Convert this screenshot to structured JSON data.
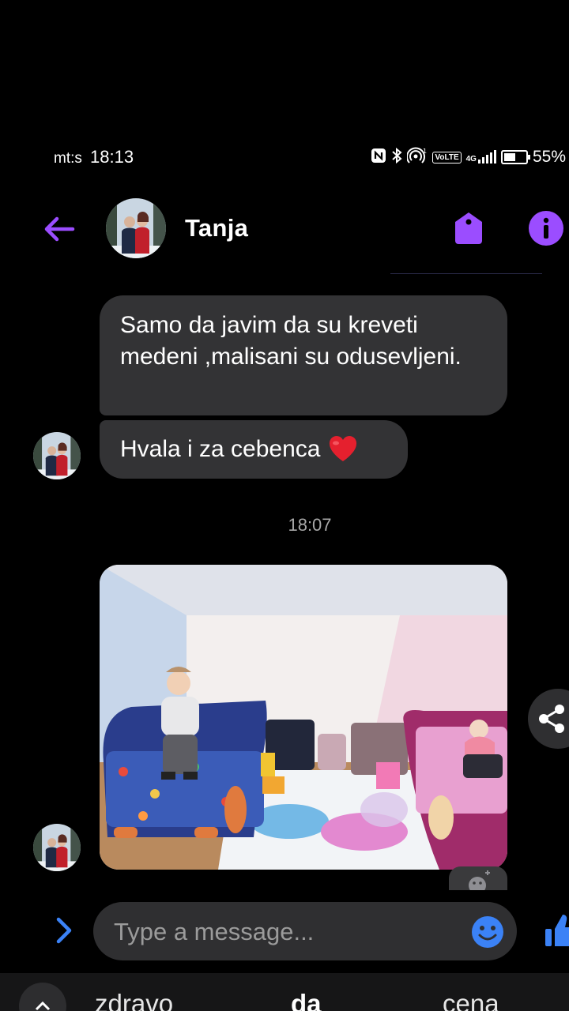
{
  "status_bar": {
    "carrier": "mt:s",
    "time": "18:13",
    "volte": "VoLTE",
    "network": "4G",
    "battery": "55%",
    "battery_level": 0.55,
    "icons": [
      "nfc-icon",
      "bluetooth-icon",
      "hotspot-icon",
      "volte-icon",
      "signal-icon",
      "battery-icon"
    ]
  },
  "header": {
    "contact_name": "Tanja",
    "icons": [
      "back-arrow-icon",
      "tag-icon",
      "info-icon"
    ],
    "accent": "#9B4DFF"
  },
  "messages": [
    {
      "text": "Samo da javim da su kreveti medeni ,malisani su odusevljeni."
    },
    {
      "text": "Hvala i za cebenca",
      "emoji": "red-heart"
    }
  ],
  "timestamp": "18:07",
  "photo_message": {
    "icons": [
      "share-icon",
      "add-reaction-icon"
    ]
  },
  "composer": {
    "placeholder": "Type a message...",
    "icons": [
      "expand-chevron-icon",
      "emoji-icon",
      "like-icon"
    ],
    "icon_color": "#3B82F6"
  },
  "keyboard_suggestions": [
    "zdravo",
    "da",
    "cena"
  ]
}
